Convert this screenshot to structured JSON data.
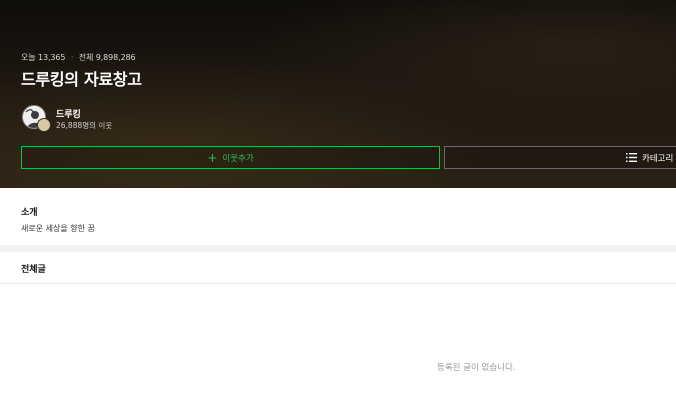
{
  "hero": {
    "stats": {
      "today_label": "오늘",
      "today_count": "13,365",
      "separator": "·",
      "total_label": "전체",
      "total_count": "9,898,286"
    },
    "blog_title": "드루킹의 자료창고",
    "owner": {
      "name": "드루킹",
      "neighbors": "26,888명의 이웃"
    },
    "buttons": {
      "add_neighbor": "이웃추가",
      "category": "카테고리"
    }
  },
  "intro": {
    "heading": "소개",
    "text": "새로운 세상을 향한 꿈"
  },
  "posts": {
    "heading": "전체글",
    "empty_message": "등록된 글이 없습니다."
  },
  "colors": {
    "accent_green": "#2cc05a",
    "hero_dark": "#1c1710"
  },
  "icons": {
    "plus": "plus-icon",
    "menu": "menu-list-icon"
  }
}
